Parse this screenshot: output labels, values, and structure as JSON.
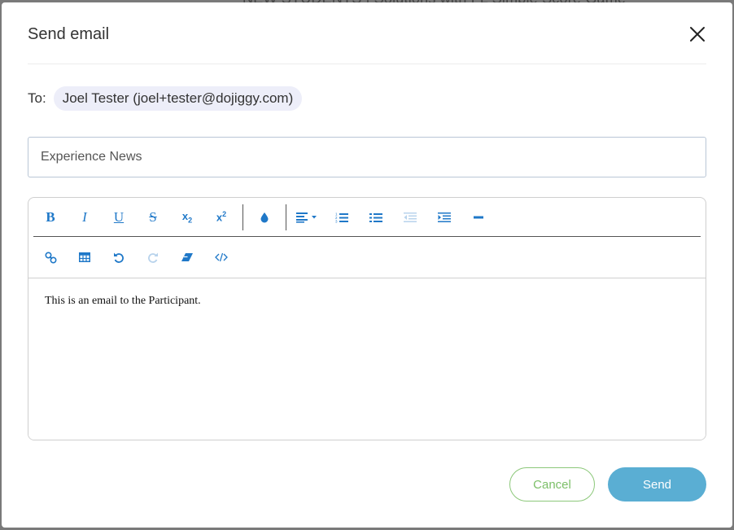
{
  "background": {
    "partial_text": "NEW STUDENTS  |  Solutions with FL  Simple Score Game"
  },
  "dialog": {
    "title": "Send email",
    "close_icon": "close-icon",
    "to_label": "To:",
    "recipient": "Joel Tester (joel+tester@dojiggy.com)",
    "subject_value": "Experience News"
  },
  "toolbar": {
    "row1": [
      {
        "name": "bold-button",
        "icon": "bold-icon",
        "glyph": "B",
        "enabled": true
      },
      {
        "name": "italic-button",
        "icon": "italic-icon",
        "glyph": "I",
        "enabled": true
      },
      {
        "name": "underline-button",
        "icon": "underline-icon",
        "glyph": "U",
        "enabled": true
      },
      {
        "name": "strikethrough-button",
        "icon": "strikethrough-icon",
        "glyph": "S",
        "enabled": true
      },
      {
        "name": "subscript-button",
        "icon": "subscript-icon",
        "glyph": "x₂",
        "enabled": true
      },
      {
        "name": "superscript-button",
        "icon": "superscript-icon",
        "glyph": "x²",
        "enabled": true
      },
      {
        "name": "text-color-button",
        "icon": "color-drop-icon",
        "enabled": true
      },
      {
        "name": "align-dropdown",
        "icon": "align-left-icon",
        "enabled": true
      },
      {
        "name": "ordered-list-button",
        "icon": "ordered-list-icon",
        "enabled": true
      },
      {
        "name": "unordered-list-button",
        "icon": "bullet-list-icon",
        "enabled": true
      },
      {
        "name": "outdent-button",
        "icon": "outdent-icon",
        "enabled": false
      },
      {
        "name": "indent-button",
        "icon": "indent-icon",
        "enabled": true
      },
      {
        "name": "horizontal-rule-button",
        "icon": "horizontal-rule-icon",
        "enabled": true
      }
    ],
    "row2": [
      {
        "name": "link-button",
        "icon": "link-icon",
        "enabled": true
      },
      {
        "name": "table-button",
        "icon": "table-icon",
        "enabled": true
      },
      {
        "name": "undo-button",
        "icon": "undo-icon",
        "enabled": true
      },
      {
        "name": "redo-button",
        "icon": "redo-icon",
        "enabled": false
      },
      {
        "name": "clear-format-button",
        "icon": "eraser-icon",
        "enabled": true
      },
      {
        "name": "source-code-button",
        "icon": "code-icon",
        "enabled": true
      }
    ]
  },
  "editor": {
    "body": "This is an email to the Participant."
  },
  "footer": {
    "cancel_label": "Cancel",
    "send_label": "Send"
  },
  "colors": {
    "accent_blue": "#1f78c8",
    "send_bg": "#5aaed3",
    "cancel_border": "#8cc87a",
    "chip_bg": "#edeef9"
  }
}
